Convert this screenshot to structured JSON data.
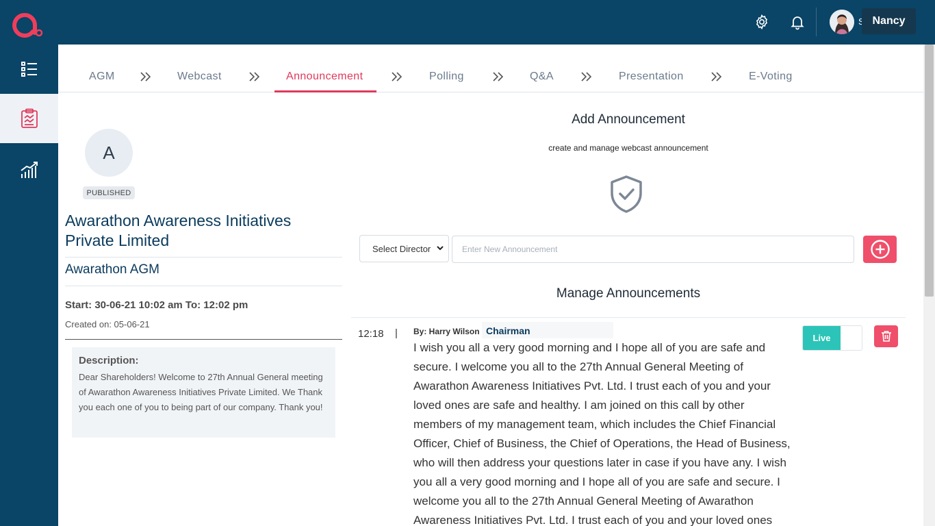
{
  "topbar": {
    "logo_icon": "app-logo-icon",
    "settings_icon": "gear-icon",
    "notifications_icon": "bell-icon",
    "user_initial": "S",
    "user_name": "Nancy"
  },
  "sidebar": {
    "items": [
      {
        "icon": "list-icon"
      },
      {
        "icon": "clipboard-chart-icon",
        "active": true
      },
      {
        "icon": "analytics-icon"
      }
    ]
  },
  "tabs": [
    {
      "label": "AGM"
    },
    {
      "label": "Webcast"
    },
    {
      "label": "Announcement",
      "active": true
    },
    {
      "label": "Polling"
    },
    {
      "label": "Q&A"
    },
    {
      "label": "Presentation"
    },
    {
      "label": "E-Voting"
    }
  ],
  "event": {
    "avatar_letter": "A",
    "status": "PUBLISHED",
    "company": "Awarathon Awareness Initiatives Private Limited",
    "agm_name": "Awarathon AGM",
    "start": "Start: 30-06-21 10:02 am To: 12:02 pm",
    "created": "Created on: 05-06-21",
    "description_title": "Description:",
    "description": "Dear Shareholders! Welcome to 27th Annual General meeting of Awarathon Awareness Initiatives Private Limited. We Thank you each one of you to being part of our company. Thank you!"
  },
  "add_announcement": {
    "title": "Add Announcement",
    "subtitle": "create and manage webcast announcement",
    "select_label": "Select Director",
    "input_placeholder": "Enter New Announcement",
    "input_value": ""
  },
  "manage": {
    "title": "Manage Announcements",
    "items": [
      {
        "time": "12:18",
        "separator": "|",
        "by": "By: Harry Wilson",
        "role": "Chairman",
        "text": "I wish you all a very good morning and I hope all of you are safe and secure. I welcome you all to the 27th Annual General Meeting of Awarathon Awareness Initiatives Pvt. Ltd. I trust each of you and your loved ones are safe and healthy. I am joined on this call by other members of my management team, which includes the Chief Financial Officer, Chief of Business, the Chief of Operations, the Head of Business, who will then address your questions later in case if you have any. I wish you all a very good morning and I hope all of you are safe and secure. I welcome you all to the 27th Annual General Meeting of Awarathon Awareness Initiatives Pvt. Ltd. I trust each of you and your loved ones are safe and healthy.",
        "toggle_label": "Live"
      }
    ]
  },
  "colors": {
    "navy": "#0a4466",
    "accent": "#e0395b",
    "live": "#2cc4b8",
    "danger": "#ef4f6a"
  }
}
